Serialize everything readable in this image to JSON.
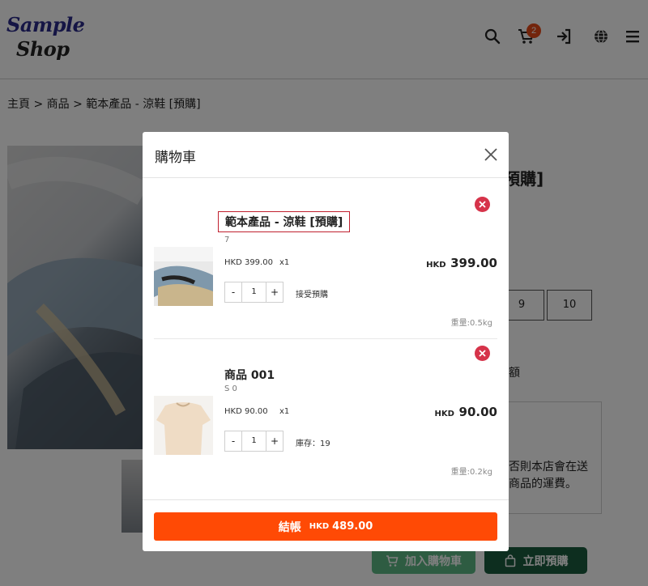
{
  "header": {
    "logo_line1": "Sample",
    "logo_line2": "Shop",
    "cart_count": "2",
    "icons": [
      "search-icon",
      "cart-icon",
      "login-icon",
      "globe-icon",
      "menu-icon"
    ]
  },
  "breadcrumb": "主頁 > 商品 > 範本產品 - 涼鞋 [預購]",
  "product": {
    "title_tail": "預購]",
    "sizes": [
      "9",
      "10"
    ],
    "info_tail": "額",
    "note_line1": "否則本店會在送",
    "note_line2": "商品的運費。",
    "add_to_cart_label": "加入購物車",
    "preorder_label": "立即預購"
  },
  "cart": {
    "title": "購物車",
    "items": [
      {
        "name": "範本產品 - 涼鞋 [預購]",
        "sub": "7",
        "price": "HKD 399.00",
        "qty_text": "x1",
        "total_currency": "HKD",
        "total_amount": "399.00",
        "minus": "-",
        "qty": "1",
        "plus": "+",
        "note": "接受預購",
        "weight": "重量:0.5kg"
      },
      {
        "name": "商品 001",
        "sub": "S   0",
        "price": "HKD 90.00",
        "qty_text": "x1",
        "total_currency": "HKD",
        "total_amount": "90.00",
        "minus": "-",
        "qty": "1",
        "plus": "+",
        "note": "庫存：19",
        "weight": "重量:0.2kg"
      }
    ],
    "checkout_label": "結帳",
    "checkout_currency": "HKD",
    "checkout_amount": "489.00"
  },
  "colors": {
    "checkout": "#ff4a05",
    "remove": "#d6334a",
    "cart_badge": "#e64a19",
    "add_to_cart": "#5cb885",
    "preorder": "#1a5c3f"
  }
}
